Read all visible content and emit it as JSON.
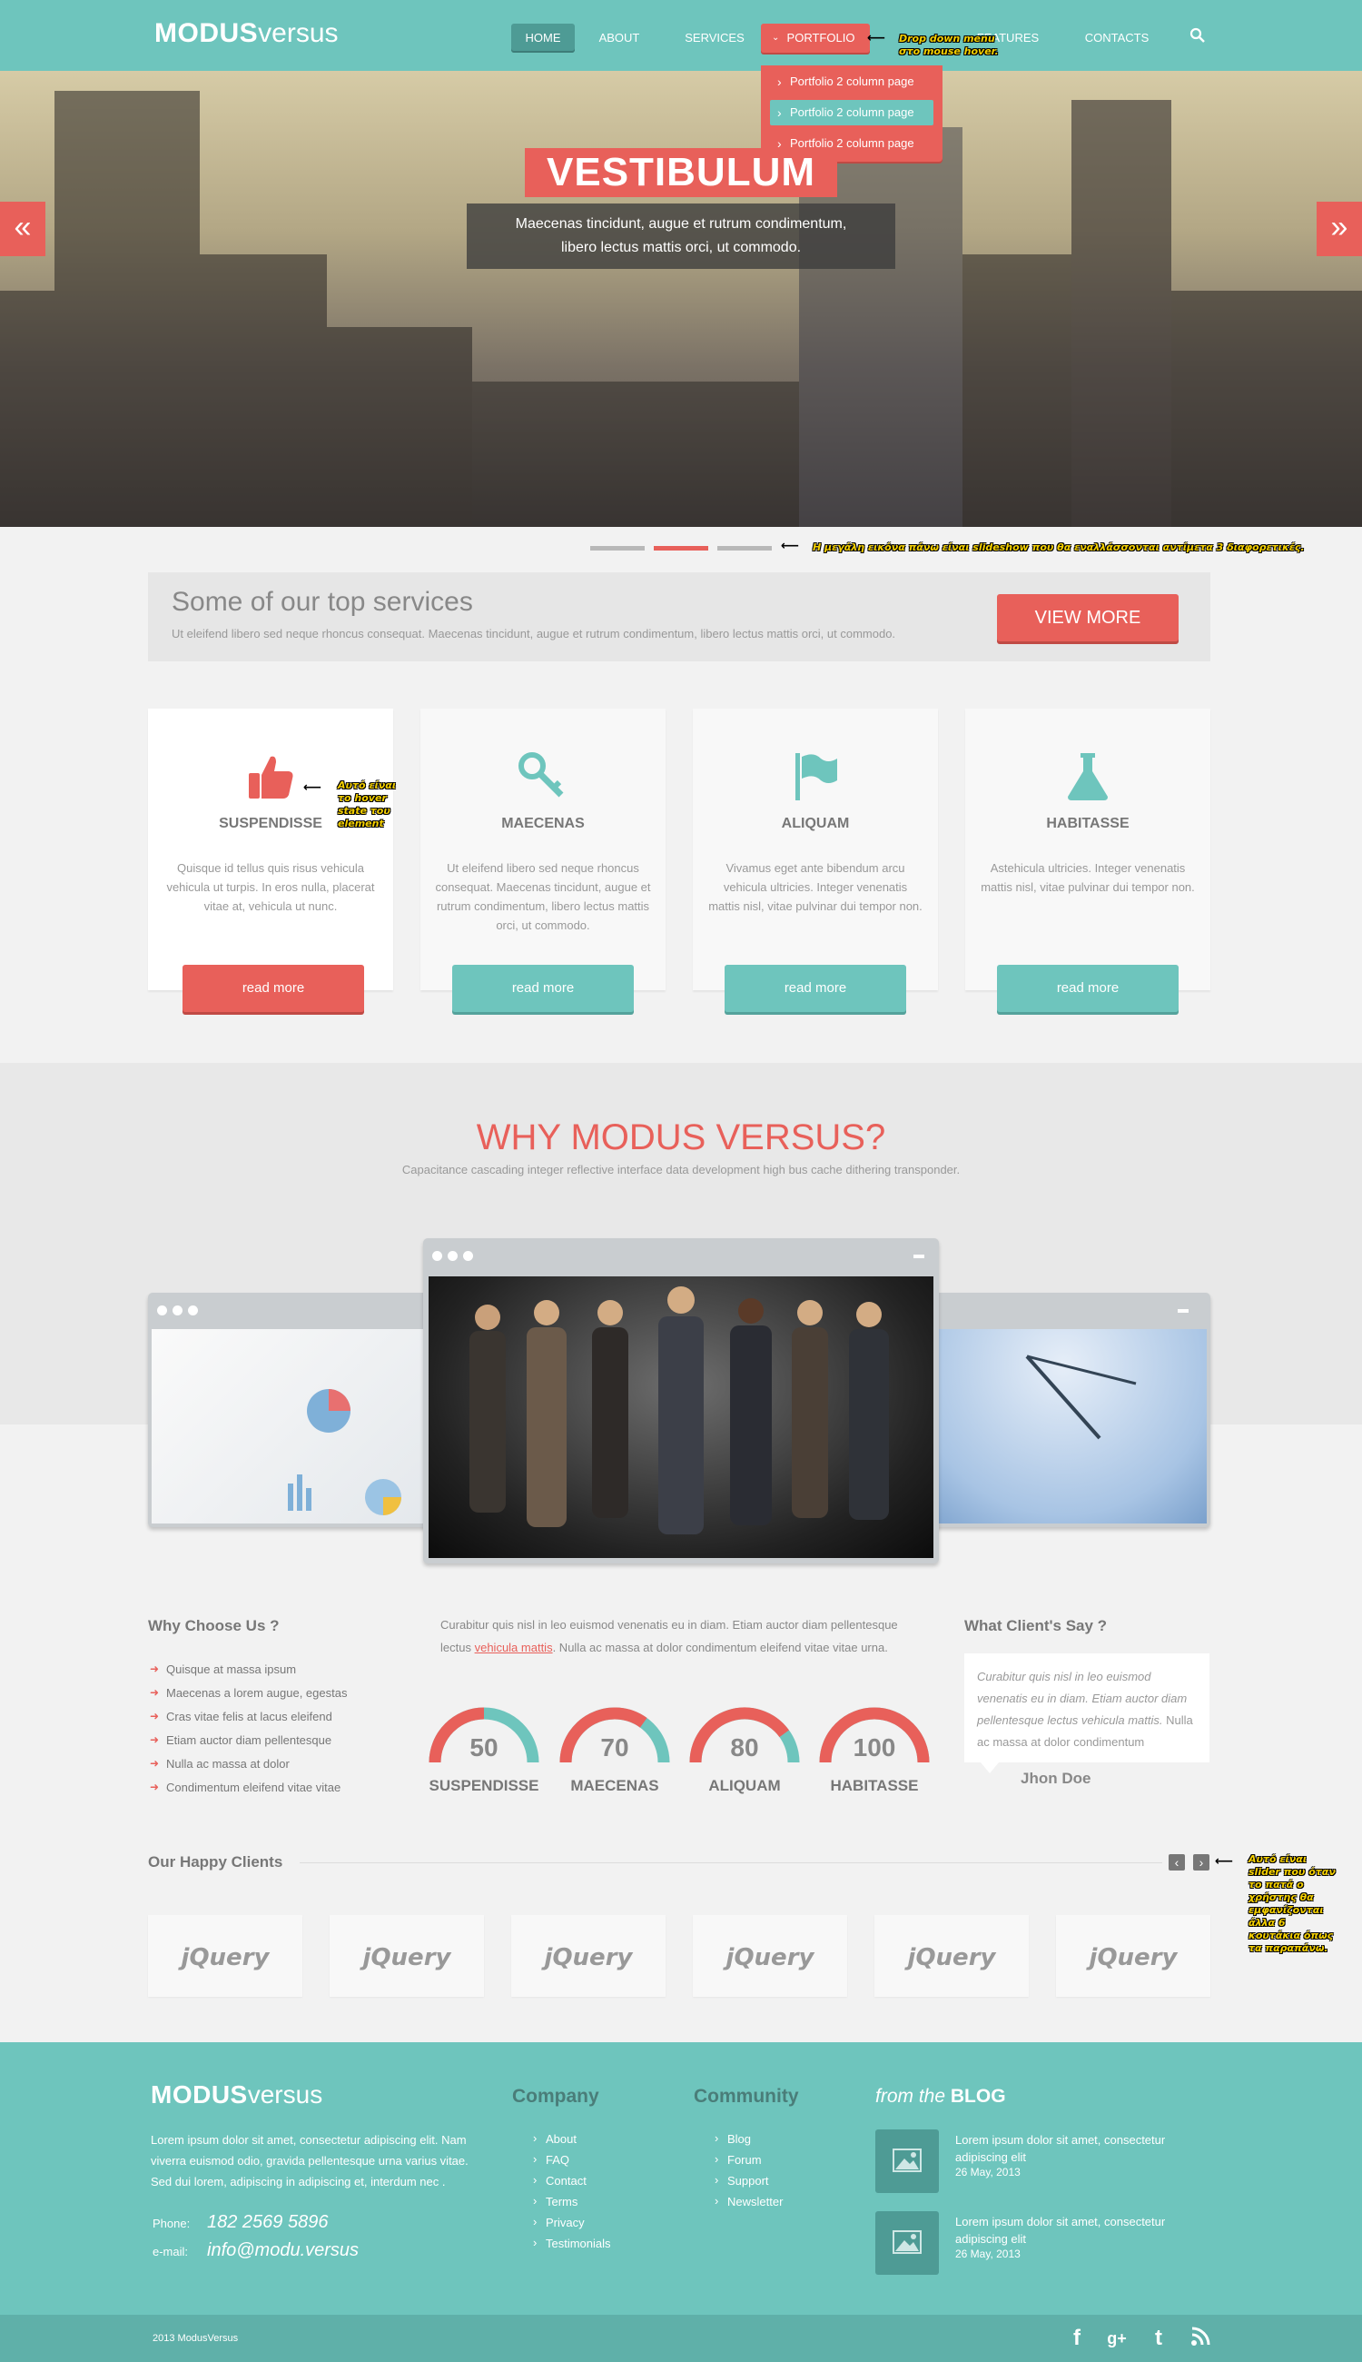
{
  "header": {
    "logo_bold": "MODUS",
    "logo_light": "versus",
    "nav": [
      "HOME",
      "ABOUT",
      "SERVICES",
      "PORTFOLIO",
      "FEATURES",
      "CONTACTS"
    ],
    "dropdown": [
      "Portfolio 2 column page",
      "Portfolio 2 column page",
      "Portfolio 2 column page"
    ],
    "dropdown_note": "Drop down menu στο mouse hover."
  },
  "hero": {
    "title": "VESTIBULUM",
    "subtitle_line1": "Maecenas tincidunt, augue et rutrum condimentum,",
    "subtitle_line2": "libero lectus mattis orci, ut commodo.",
    "slideshow_note": "Η μεγάλη εικόνα πάνω είναι slideshow που θα εναλλάσσονται αντίμετα 3 διαφορετικές."
  },
  "services": {
    "title": "Some of our top services",
    "text": "Ut eleifend libero sed neque rhoncus consequat. Maecenas tincidunt, augue et rutrum condimentum, libero lectus mattis orci, ut commodo.",
    "button": "VIEW MORE",
    "hover_note": "Αυτό είναι το hover state του element",
    "cards": [
      {
        "title": "SUSPENDISSE",
        "text": "Quisque id tellus quis risus vehicula vehicula ut turpis. In eros nulla, placerat vitae at, vehicula ut nunc.",
        "button": "read more"
      },
      {
        "title": "MAECENAS",
        "text": "Ut eleifend libero sed neque rhoncus consequat. Maecenas tincidunt, augue et rutrum condimentum, libero lectus mattis orci, ut commodo.",
        "button": "read more"
      },
      {
        "title": "ALIQUAM",
        "text": "Vivamus eget ante bibendum arcu vehicula ultricies. Integer venenatis mattis nisl, vitae pulvinar dui tempor non.",
        "button": "read more"
      },
      {
        "title": "HABITASSE",
        "text": "Astehicula ultricies. Integer venenatis mattis nisl, vitae pulvinar dui tempor non.",
        "button": "read more"
      }
    ]
  },
  "why": {
    "title": "WHY MODUS VERSUS?",
    "subtitle": "Capacitance cascading integer reflective interface data development high bus cache dithering transponder."
  },
  "choose": {
    "title": "Why Choose Us ?",
    "items": [
      "Quisque at massa ipsum",
      "Maecenas a lorem augue, egestas",
      "Cras vitae felis at lacus eleifend",
      "Etiam auctor diam pellentesque",
      "Nulla ac massa at dolor",
      "Condimentum eleifend vitae vitae"
    ]
  },
  "stats": {
    "intro_pre": "Curabitur quis nisl in leo euismod venenatis eu in diam. Etiam auctor diam pellentesque lectus",
    "intro_link": "vehicula mattis",
    "intro_post": ". Nulla ac massa at dolor condimentum eleifend vitae vitae urna.",
    "gauges": [
      {
        "value": "50",
        "label": "SUSPENDISSE",
        "fraction": 0.5
      },
      {
        "value": "70",
        "label": "MAECENAS",
        "fraction": 0.7
      },
      {
        "value": "80",
        "label": "ALIQUAM",
        "fraction": 0.8
      },
      {
        "value": "100",
        "label": "HABITASSE",
        "fraction": 1.0
      }
    ]
  },
  "testimonial": {
    "title": "What Client's Say ?",
    "quote": "Curabitur quis nisl in leo euismod venenatis eu in diam. Etiam auctor diam pellentesque lectus vehicula mattis.",
    "rest": " Nulla ac massa at dolor condimentum",
    "author": "Jhon Doe"
  },
  "clients": {
    "title": "Our Happy Clients",
    "logos": [
      "jQuery",
      "jQuery",
      "jQuery",
      "jQuery",
      "jQuery",
      "jQuery"
    ],
    "note": "Αυτό είναι slider που όταν το πατά ο χρήστης θα εμφανίζονται άλλα 6 κουτάκια όπως τα παραπάνω."
  },
  "footer": {
    "logo_bold": "MODUS",
    "logo_light": "versus",
    "about": "Lorem ipsum dolor sit amet, consectetur adipiscing elit. Nam viverra euismod odio, gravida pellentesque urna varius vitae. Sed dui lorem, adipiscing in adipiscing et, interdum nec .",
    "phone_label": "Phone:",
    "phone": "182 2569 5896",
    "email_label": "e-mail:",
    "email": "info@modu.versus",
    "company_title": "Company",
    "company_links": [
      "About",
      "FAQ",
      "Contact",
      "Terms",
      "Privacy",
      "Testimonials"
    ],
    "community_title": "Community",
    "community_links": [
      "Blog",
      "Forum",
      "Support",
      "Newsletter"
    ],
    "blog_title_pre": "from the",
    "blog_title": "BLOG",
    "posts": [
      {
        "text": "Lorem ipsum dolor sit amet, consectetur adipiscing elit",
        "date": "26 May, 2013"
      },
      {
        "text": "Lorem ipsum dolor sit amet, consectetur adipiscing elit",
        "date": "26 May, 2013"
      }
    ],
    "copyright": "2013  ModusVersus"
  },
  "colors": {
    "teal": "#6ec5bd",
    "red": "#e8605a",
    "dark_teal": "#4a7d79"
  }
}
